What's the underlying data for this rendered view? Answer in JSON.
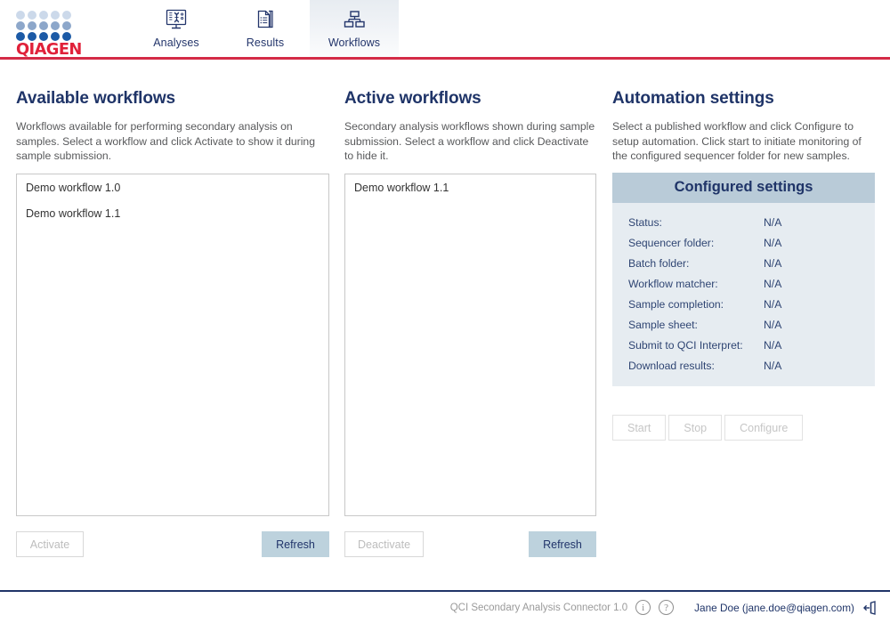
{
  "app": {
    "brand": "QIAGEN",
    "footer_app_name": "QCI Secondary Analysis Connector 1.0",
    "user": "Jane Doe (jane.doe@qiagen.com)",
    "brand_red": "#d42b47",
    "brand_navy": "#1f3468",
    "accent_button": "#bdd2dd"
  },
  "nav": {
    "items": [
      {
        "label": "Analyses",
        "icon": "dna-monitor-icon",
        "active": false
      },
      {
        "label": "Results",
        "icon": "documents-icon",
        "active": false
      },
      {
        "label": "Workflows",
        "icon": "hierarchy-icon",
        "active": true
      }
    ]
  },
  "available": {
    "title": "Available workflows",
    "description": "Workflows available for performing secondary analysis on samples. Select a workflow and click Activate to show it during sample submission.",
    "items": [
      {
        "label": "Demo workflow 1.0"
      },
      {
        "label": "Demo workflow 1.1"
      }
    ],
    "primary_button": "Activate",
    "primary_enabled": false,
    "refresh_button": "Refresh"
  },
  "active": {
    "title": "Active workflows",
    "description": "Secondary analysis workflows shown during sample submission. Select a workflow and click Deactivate to hide it.",
    "items": [
      {
        "label": "Demo workflow 1.1"
      }
    ],
    "primary_button": "Deactivate",
    "primary_enabled": false,
    "refresh_button": "Refresh"
  },
  "automation": {
    "title": "Automation settings",
    "description": "Select a published workflow and click Configure to setup automation. Click start to initiate monitoring of the configured sequencer folder for new samples.",
    "panel_title": "Configured settings",
    "settings": [
      {
        "key": "Status:",
        "value": "N/A"
      },
      {
        "key": "Sequencer folder:",
        "value": "N/A"
      },
      {
        "key": "Batch folder:",
        "value": "N/A"
      },
      {
        "key": "Workflow matcher:",
        "value": "N/A"
      },
      {
        "key": "Sample completion:",
        "value": "N/A"
      },
      {
        "key": "Sample sheet:",
        "value": "N/A"
      },
      {
        "key": "Submit to QCI Interpret:",
        "value": "N/A"
      },
      {
        "key": "Download results:",
        "value": "N/A"
      }
    ],
    "buttons": [
      {
        "label": "Start",
        "enabled": false
      },
      {
        "label": "Stop",
        "enabled": false
      },
      {
        "label": "Configure",
        "enabled": false
      }
    ]
  },
  "footer": {
    "info_icon": "i",
    "help_icon": "?"
  }
}
